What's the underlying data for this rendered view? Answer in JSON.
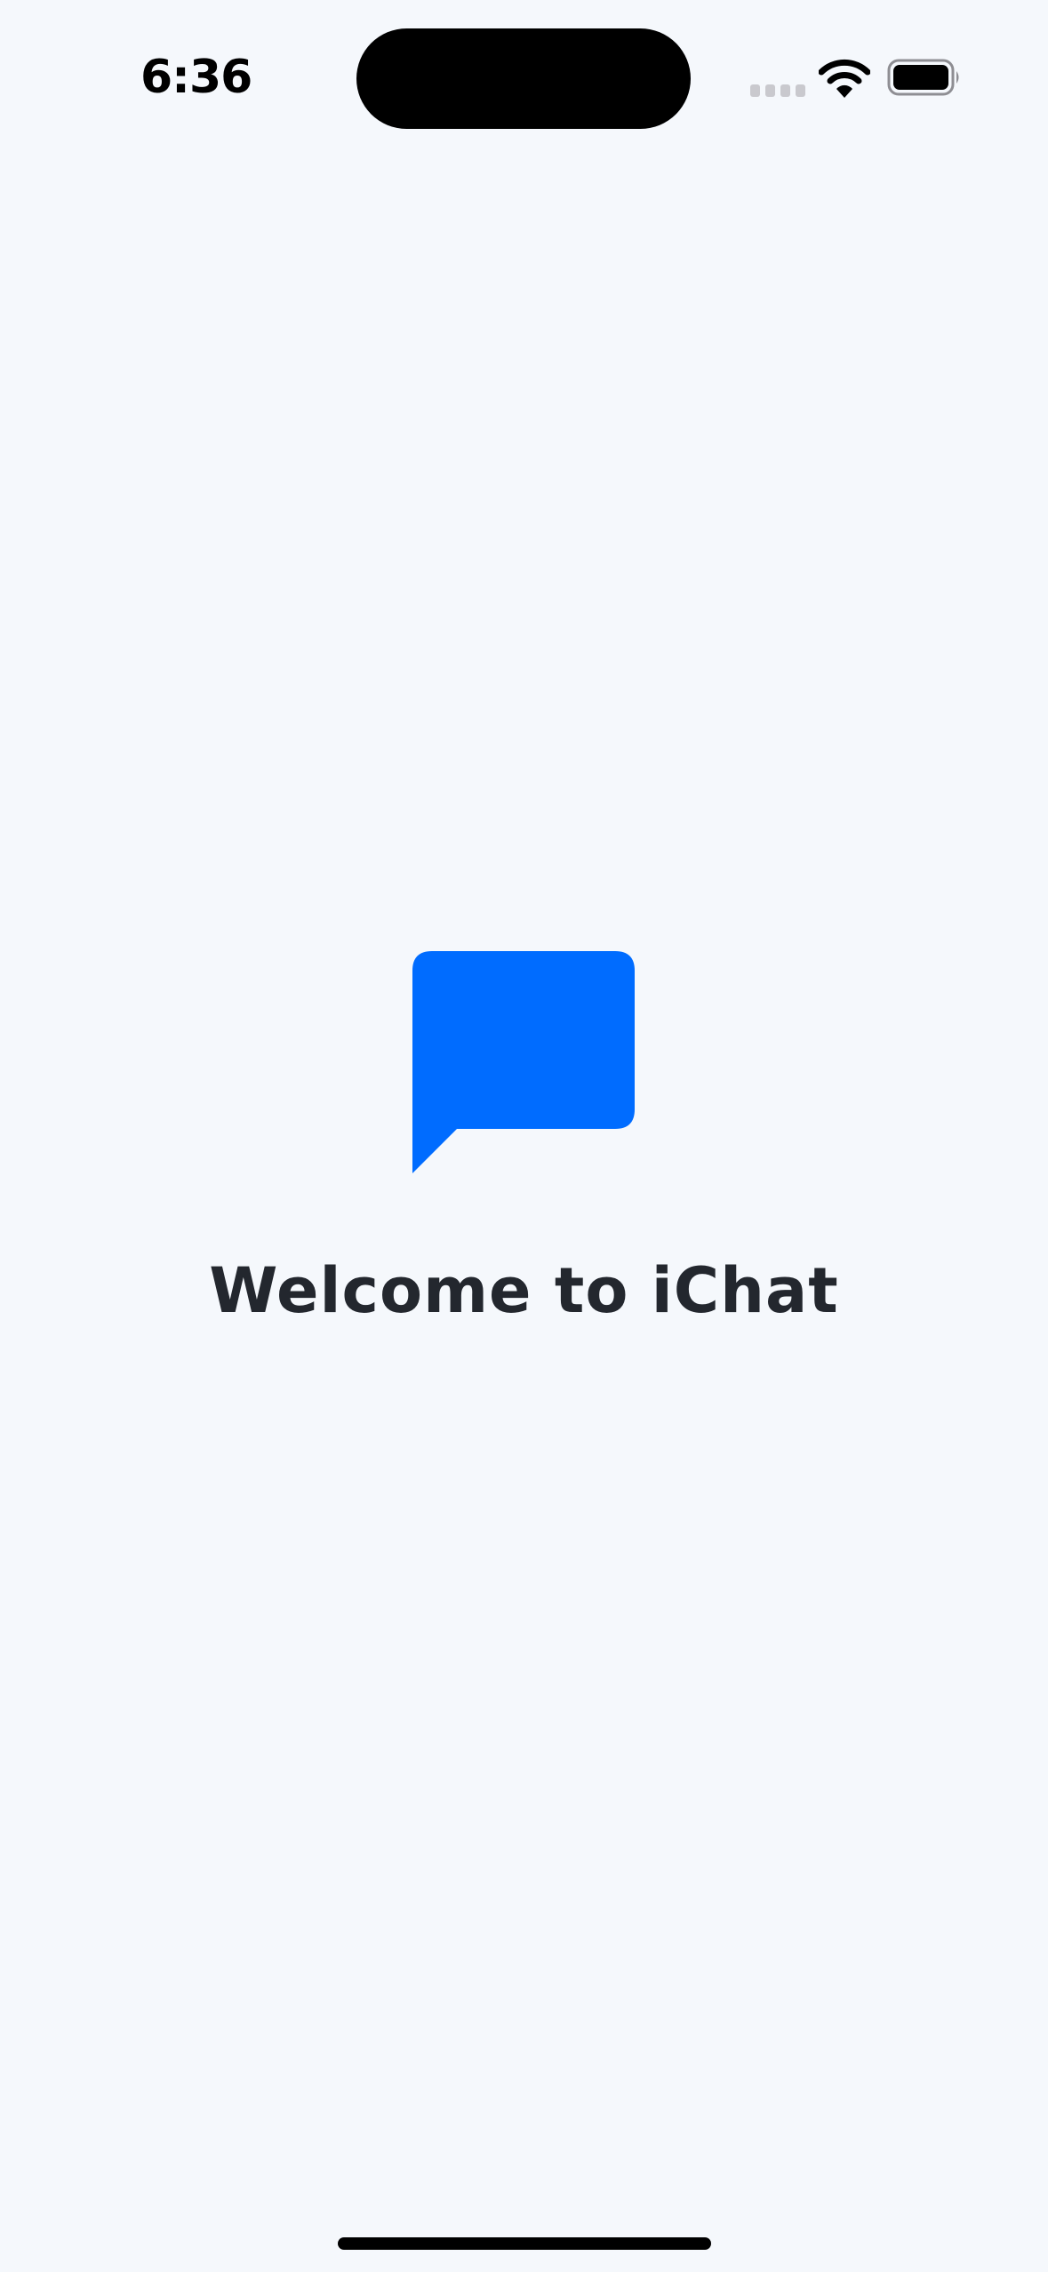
{
  "status_bar": {
    "time": "6:36",
    "signal_icon": "cellular-signal-icon",
    "wifi_icon": "wifi-icon",
    "battery_icon": "battery-icon"
  },
  "welcome": {
    "logo_icon": "chat-bubble-icon",
    "title": "Welcome to iChat"
  },
  "colors": {
    "background": "#f5f8fc",
    "accent": "#006cff",
    "title_text": "#23272e",
    "signal_inactive": "#c9c9ce"
  }
}
